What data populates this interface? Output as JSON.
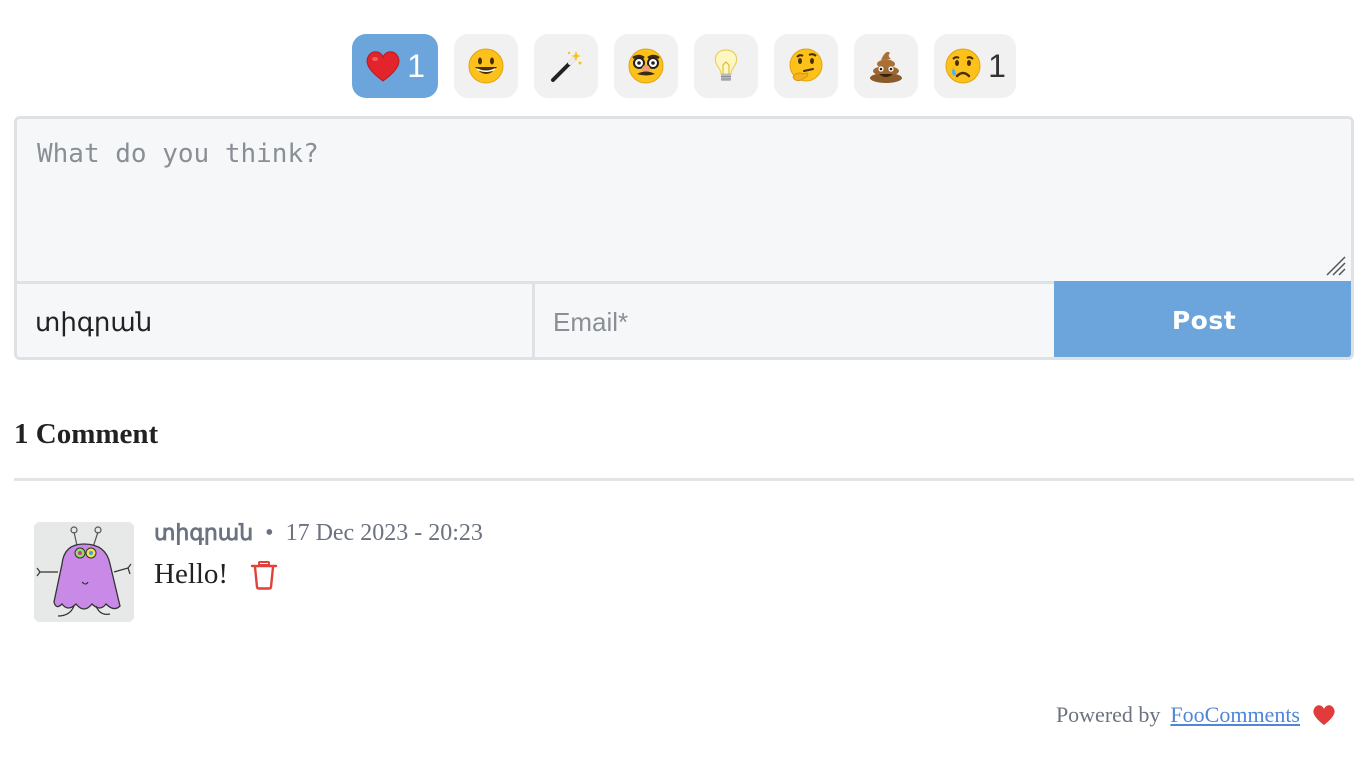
{
  "reactions": [
    {
      "name": "heart",
      "emoji": "❤️",
      "count": "1",
      "active": true
    },
    {
      "name": "grinning",
      "emoji": "😀",
      "count": "",
      "active": false
    },
    {
      "name": "magic-wand",
      "emoji": "🪄",
      "count": "",
      "active": false
    },
    {
      "name": "disguise",
      "emoji": "🥸",
      "count": "",
      "active": false
    },
    {
      "name": "light-bulb",
      "emoji": "💡",
      "count": "",
      "active": false
    },
    {
      "name": "thinking",
      "emoji": "🤔",
      "count": "",
      "active": false
    },
    {
      "name": "poop",
      "emoji": "💩",
      "count": "",
      "active": false
    },
    {
      "name": "crying",
      "emoji": "😢",
      "count": "1",
      "active": false
    }
  ],
  "form": {
    "comment_placeholder": "What do you think?",
    "comment_value": "",
    "name_value": "տիգրան",
    "name_placeholder": "",
    "email_placeholder": "Email*",
    "email_value": "",
    "post_label": "Post"
  },
  "comments_section": {
    "title": "1 Comment",
    "comments": [
      {
        "author": "տիգրան",
        "separator": "•",
        "timestamp": "17 Dec 2023 - 20:23",
        "text": "Hello!"
      }
    ]
  },
  "footer": {
    "powered_by": "Powered by",
    "link_text": "FooComments"
  },
  "colors": {
    "accent": "#6ca5db",
    "delete": "#e0413a",
    "heart": "#e23b3b",
    "link": "#4f86d9"
  }
}
